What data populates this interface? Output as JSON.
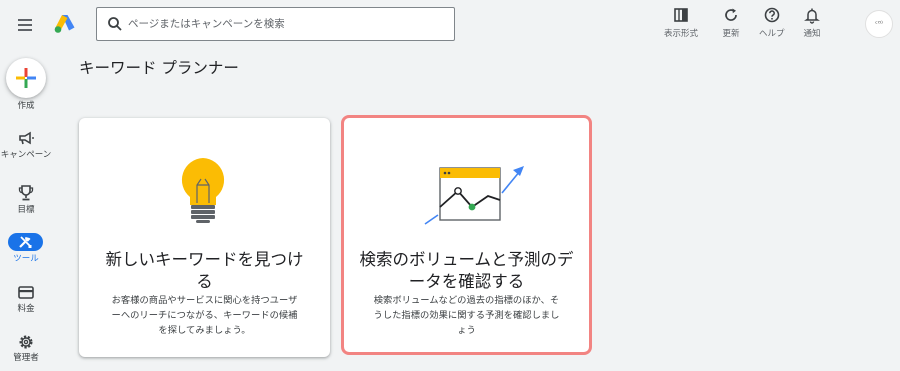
{
  "header": {
    "search_placeholder": "ページまたはキャンペーンを検索",
    "tools": [
      {
        "label": "表示形式",
        "icon": "appearance-icon"
      },
      {
        "label": "更新",
        "icon": "refresh-icon"
      },
      {
        "label": "ヘルプ",
        "icon": "help-icon"
      },
      {
        "label": "通知",
        "icon": "notification-bell-icon"
      }
    ],
    "avatar_text": "ᶜᴼ⁾"
  },
  "nav": {
    "create_label": "作成",
    "items": [
      {
        "label": "キャンペーン",
        "icon": "megaphone-icon"
      },
      {
        "label": "目標",
        "icon": "trophy-icon"
      },
      {
        "label": "ツール",
        "icon": "tools-icon",
        "active": true
      },
      {
        "label": "料金",
        "icon": "credit-card-icon"
      },
      {
        "label": "管理者",
        "icon": "gear-icon"
      }
    ]
  },
  "page": {
    "title": "キーワード プランナー"
  },
  "cards": [
    {
      "title_line1": "新しいキーワードを見つけ",
      "title_line2": "る",
      "desc_line1": "お客様の商品やサービスに関心を持つユーザ",
      "desc_line2": "ーへのリーチにつながる、キーワードの候補",
      "desc_line3": "を探してみましょう。",
      "icon": "lightbulb-icon"
    },
    {
      "title_line1": "検索のボリュームと予測のデ",
      "title_line2": "ータを確認する",
      "desc_line1": "検索ボリュームなどの過去の指標のほか、そ",
      "desc_line2": "うした指標の効果に関する予測を確認しまし",
      "desc_line3": "ょう",
      "icon": "trend-chart-icon"
    }
  ],
  "colors": {
    "accent": "#1a73e8",
    "highlight_border": "#f28482",
    "bulb": "#fbbc04",
    "chart_line": "#4285f4",
    "chart_point": "#34a853"
  }
}
